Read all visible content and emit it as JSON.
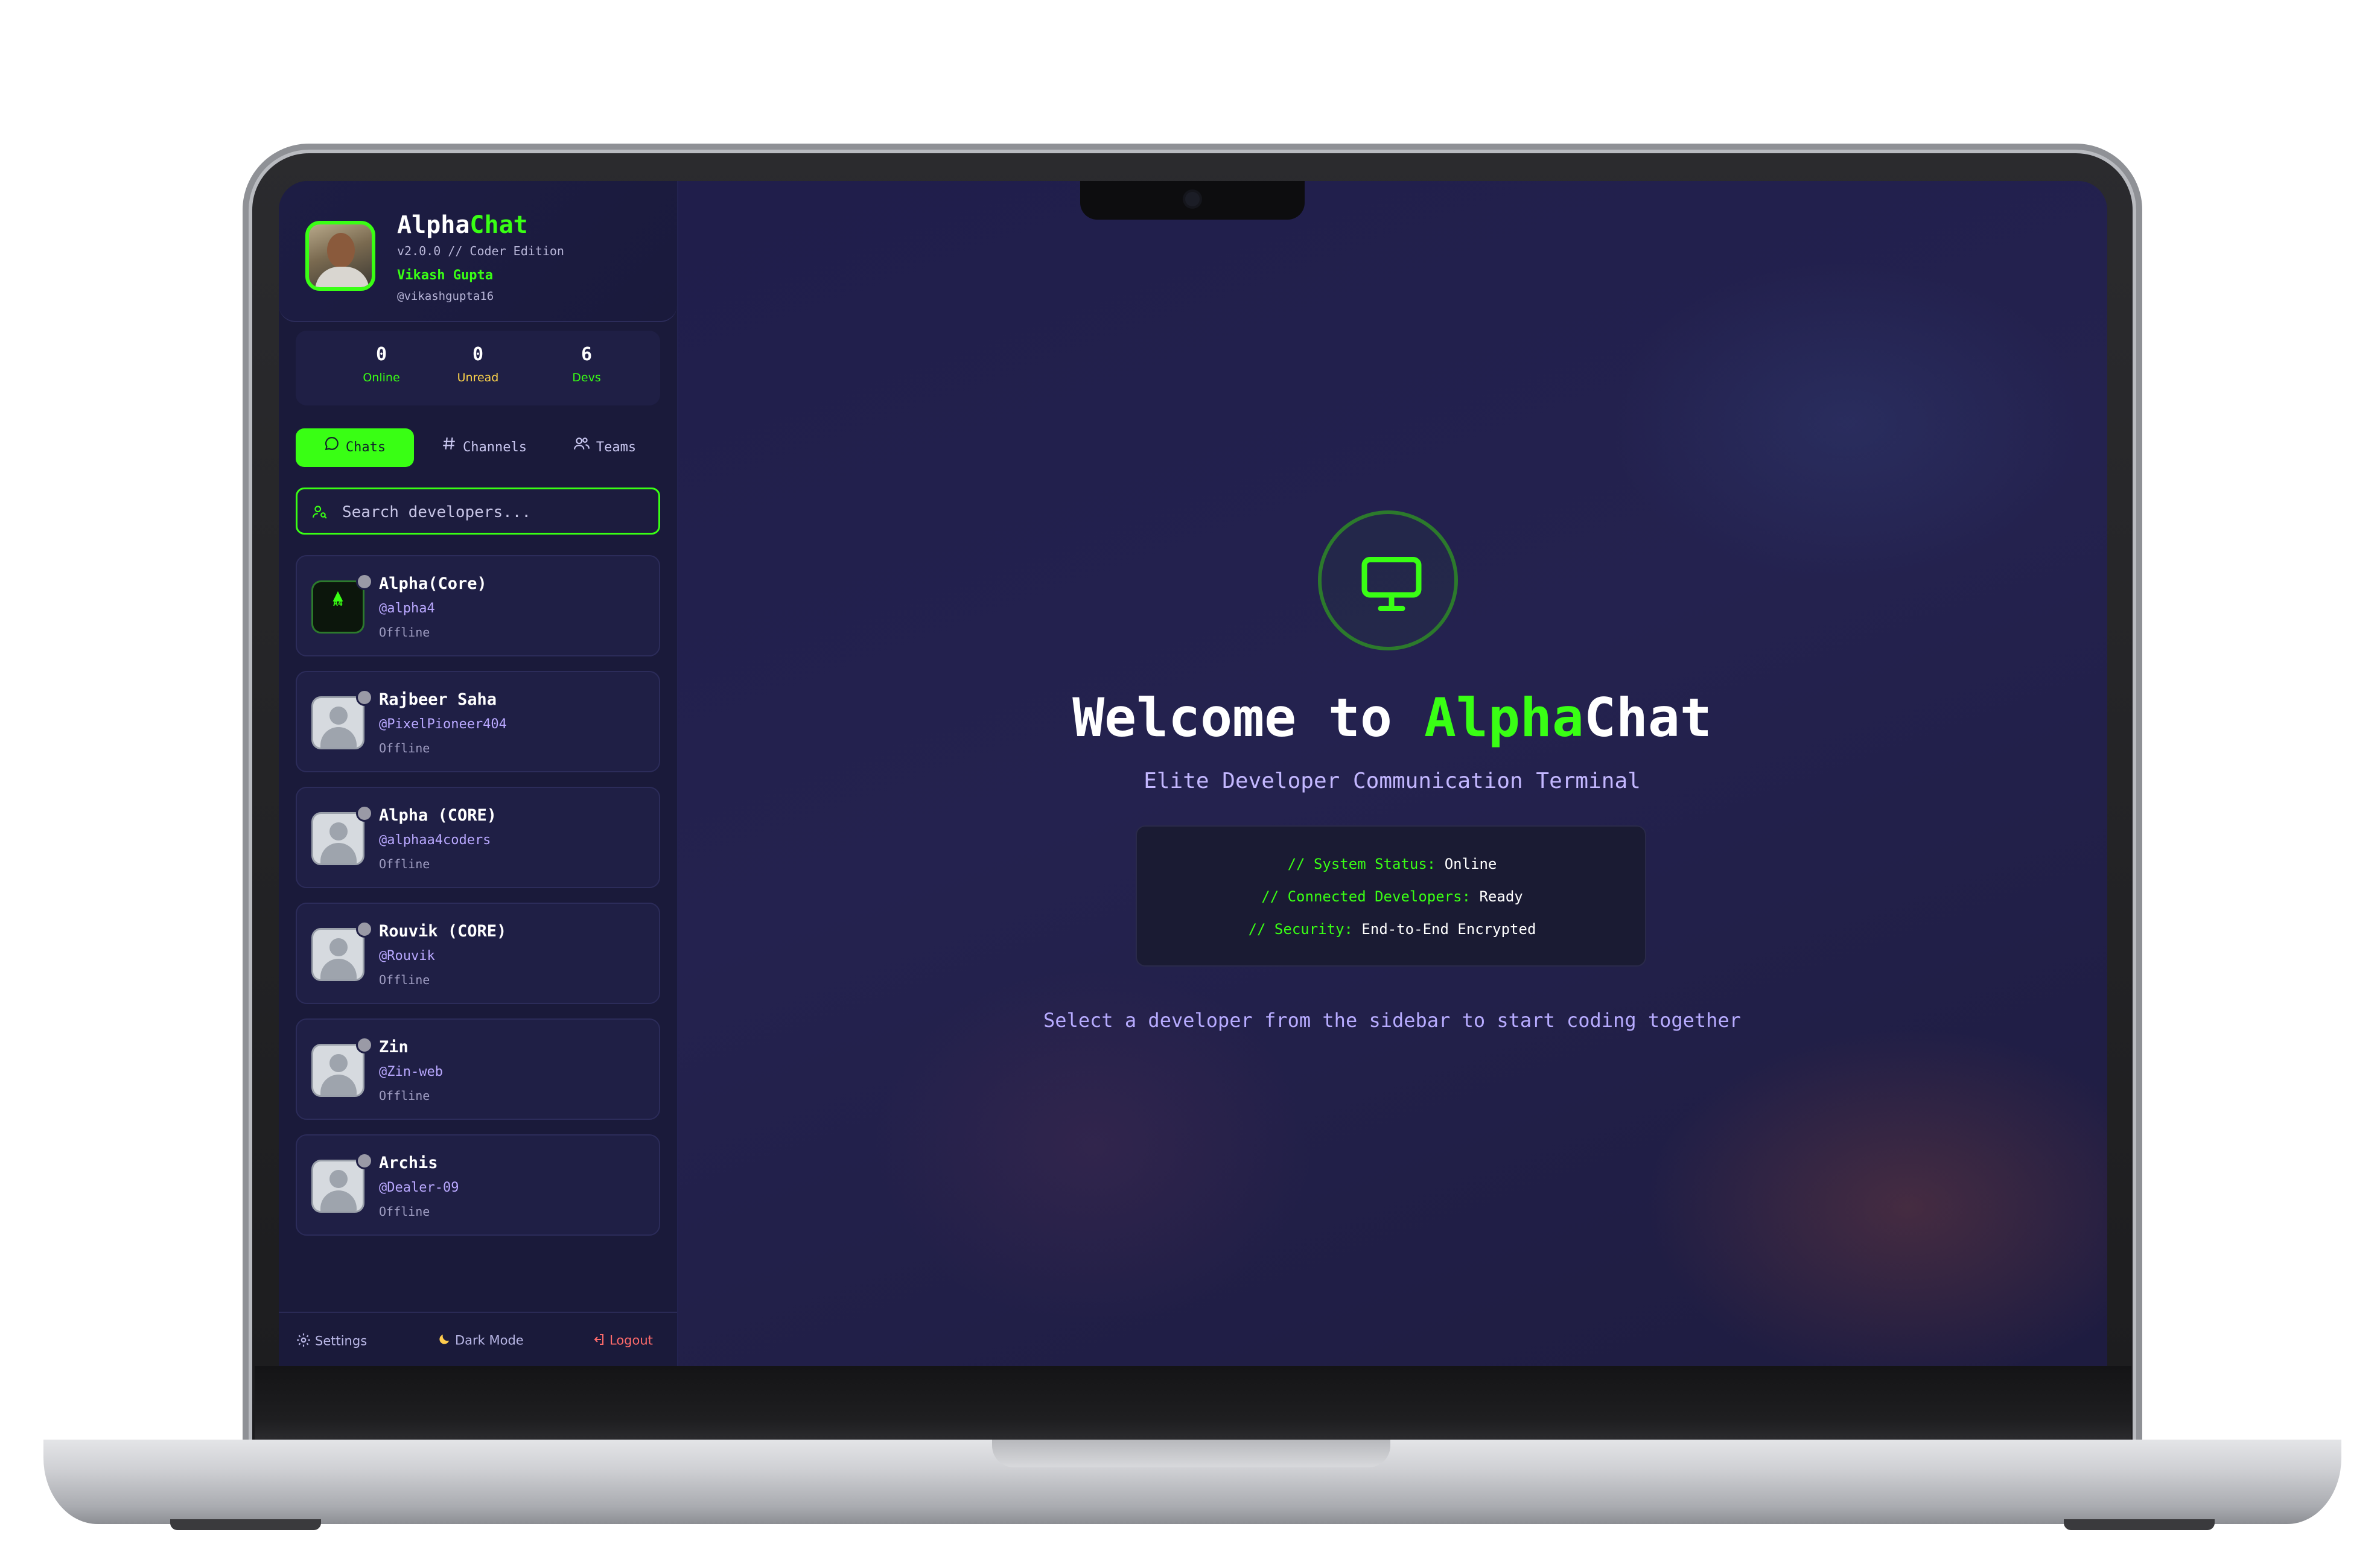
{
  "app": {
    "title_main": "Alpha",
    "title_accent": "Chat",
    "version": "v2.0.0 // Coder Edition",
    "user_name": "Vikash Gupta",
    "user_handle": "@vikashgupta16"
  },
  "stats": [
    {
      "value": "0",
      "label": "Online",
      "color": "#39ff14"
    },
    {
      "value": "0",
      "label": "Unread",
      "color": "#ffd54a"
    },
    {
      "value": "6",
      "label": "Devs",
      "color": "#39ff14"
    }
  ],
  "tabs": [
    {
      "label": "Chats",
      "icon": "chat-bubble-icon",
      "active": true
    },
    {
      "label": "Channels",
      "icon": "hash-icon",
      "active": false
    },
    {
      "label": "Teams",
      "icon": "users-icon",
      "active": false
    }
  ],
  "search": {
    "placeholder": "Search developers...",
    "icon": "user-search-icon"
  },
  "contacts": [
    {
      "name": "Alpha(Core)",
      "handle": "@alpha4",
      "status": "Offline",
      "avatar": "coders-logo"
    },
    {
      "name": "Rajbeer Saha",
      "handle": "@PixelPioneer404",
      "status": "Offline",
      "avatar": "default-avatar"
    },
    {
      "name": "Alpha (CORE)",
      "handle": "@alphaa4coders",
      "status": "Offline",
      "avatar": "default-avatar"
    },
    {
      "name": "Rouvik (CORE)",
      "handle": "@Rouvik",
      "status": "Offline",
      "avatar": "default-avatar"
    },
    {
      "name": "Zin",
      "handle": "@Zin-web",
      "status": "Offline",
      "avatar": "default-avatar"
    },
    {
      "name": "Archis",
      "handle": "@Dealer-09",
      "status": "Offline",
      "avatar": "default-avatar"
    }
  ],
  "footer": {
    "settings": "Settings",
    "dark_mode": "Dark Mode",
    "logout": "Logout"
  },
  "main": {
    "welcome_prefix": "Welcome to ",
    "welcome_accent": "Alpha",
    "welcome_suffix": "Chat",
    "subtitle": "Elite Developer Communication Terminal",
    "status": [
      {
        "key": "// System Status:",
        "value": "Online"
      },
      {
        "key": "// Connected Developers:",
        "value": "Ready"
      },
      {
        "key": "// Security:",
        "value": "End-to-End Encrypted"
      }
    ],
    "hint": "Select a developer from the sidebar to start coding together"
  },
  "colors": {
    "accent": "#39ff14",
    "background": "#1f1d4a",
    "sidebar": "#1a1a3a",
    "logout": "#ff6b6b"
  }
}
